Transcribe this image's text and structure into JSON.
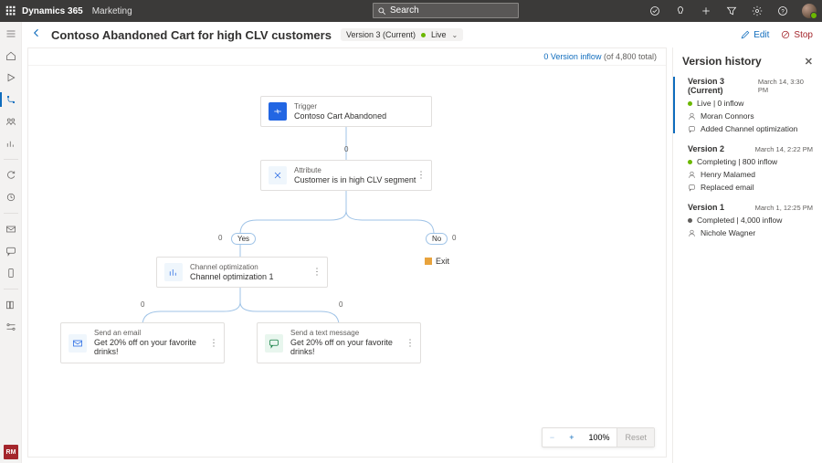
{
  "app": {
    "brand": "Dynamics 365",
    "area": "Marketing",
    "search_placeholder": "Search"
  },
  "header": {
    "title": "Contoso Abandoned Cart for high CLV customers",
    "version_chip": "Version 3 (Current)",
    "status": "Live",
    "edit": "Edit",
    "stop": "Stop"
  },
  "inflow": {
    "link": "0 Version inflow",
    "suffix": " (of 4,800 total)"
  },
  "nodes": {
    "trigger": {
      "label": "Trigger",
      "value": "Contoso Cart Abandoned"
    },
    "attribute": {
      "label": "Attribute",
      "value": "Customer is in high CLV segment"
    },
    "yes": "Yes",
    "no": "No",
    "exit": "Exit",
    "chanopt": {
      "label": "Channel optimization",
      "value": "Channel optimization 1"
    },
    "email": {
      "label": "Send an email",
      "value": "Get 20% off on your favorite drinks!"
    },
    "sms": {
      "label": "Send a text message",
      "value": "Get 20% off on your favorite drinks!"
    }
  },
  "counts": {
    "c1": "0",
    "yes": "0",
    "no": "0",
    "left": "0",
    "right": "0"
  },
  "zoom": {
    "value": "100%",
    "reset": "Reset"
  },
  "panel": {
    "title": "Version history",
    "versions": [
      {
        "name": "Version 3 (Current)",
        "date": "March 14, 3:30 PM",
        "status": "Live | 0 inflow",
        "dot": "live",
        "user": "Moran Connors",
        "note": "Added Channel optimization"
      },
      {
        "name": "Version 2",
        "date": "March 14, 2:22 PM",
        "status": "Completing | 800 inflow",
        "dot": "live",
        "user": "Henry Malamed",
        "note": "Replaced email"
      },
      {
        "name": "Version 1",
        "date": "March 1, 12:25 PM",
        "status": "Completed | 4,000 inflow",
        "dot": "done",
        "user": "Nichole Wagner",
        "note": ""
      }
    ]
  },
  "badge": "RM"
}
